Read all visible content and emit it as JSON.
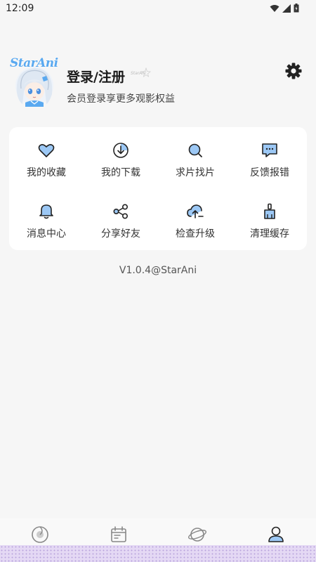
{
  "status_bar": {
    "time": "12:09",
    "icons": [
      "wifi-icon",
      "signal-icon",
      "battery-icon"
    ]
  },
  "profile": {
    "avatar_logo": "StarAni",
    "title": "登录/注册",
    "subtitle": "会员登录享更多观影权益",
    "badge_text": "StarAni"
  },
  "settings": {
    "icon": "gear-icon"
  },
  "grid": {
    "items": [
      {
        "label": "我的收藏",
        "icon": "heart-icon"
      },
      {
        "label": "我的下载",
        "icon": "download-icon"
      },
      {
        "label": "求片找片",
        "icon": "search-icon"
      },
      {
        "label": "反馈报错",
        "icon": "feedback-icon"
      },
      {
        "label": "消息中心",
        "icon": "bell-icon"
      },
      {
        "label": "分享好友",
        "icon": "share-icon"
      },
      {
        "label": "检查升级",
        "icon": "cloud-upload-icon"
      },
      {
        "label": "清理缓存",
        "icon": "broom-icon"
      }
    ]
  },
  "version": "V1.0.4@StarAni",
  "bottom_nav": {
    "items": [
      {
        "icon": "home-icon",
        "active": false
      },
      {
        "icon": "calendar-icon",
        "active": false
      },
      {
        "icon": "planet-icon",
        "active": false
      },
      {
        "icon": "profile-icon",
        "active": true
      }
    ]
  },
  "colors": {
    "accent": "#3d8fe6",
    "accent_light": "#9cc8f5",
    "background": "#f6f6f6",
    "card": "#ffffff"
  }
}
